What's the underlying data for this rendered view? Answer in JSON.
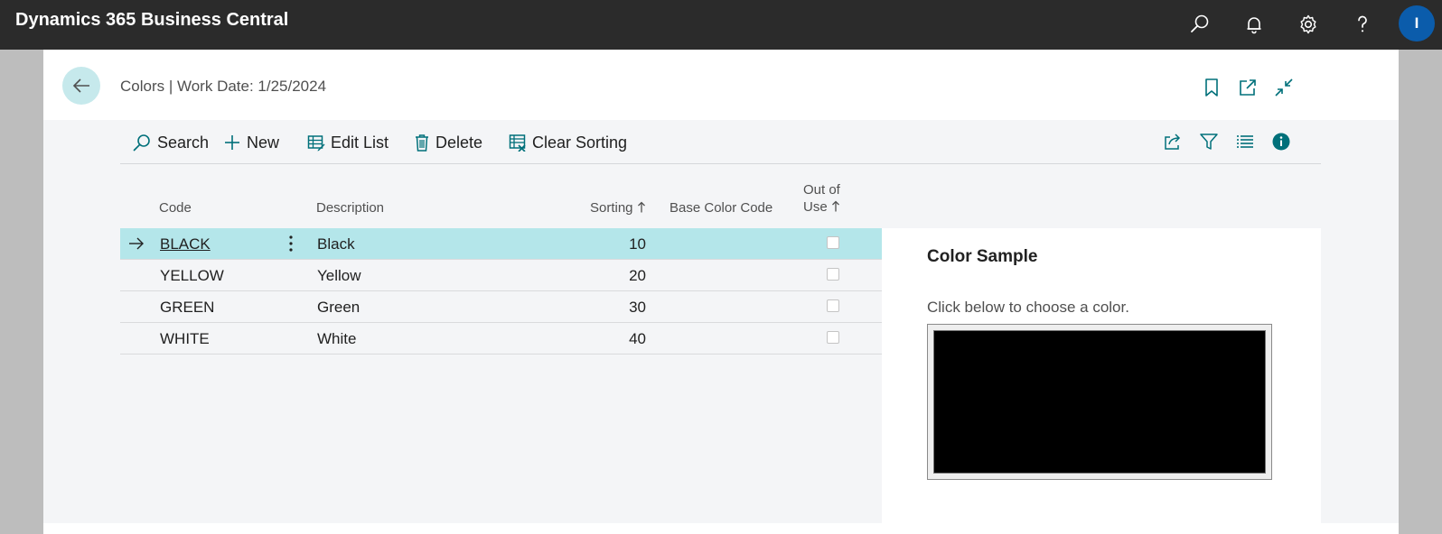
{
  "app": {
    "title": "Dynamics 365 Business Central",
    "user_initial": "I",
    "icons": [
      "search-icon",
      "bell-icon",
      "gear-icon",
      "help-icon"
    ]
  },
  "page": {
    "title": "Colors | Work Date: 1/25/2024"
  },
  "actions": {
    "search": "Search",
    "new": "New",
    "edit_list": "Edit List",
    "delete": "Delete",
    "clear_sorting": "Clear Sorting"
  },
  "list": {
    "columns": {
      "code": "Code",
      "description": "Description",
      "sorting": "Sorting",
      "base_color_code": "Base Color Code",
      "out_of_use_line1": "Out of",
      "out_of_use_line2": "Use"
    },
    "rows": [
      {
        "code": "BLACK",
        "description": "Black",
        "sorting": "10",
        "base_color_code": "",
        "out_of_use": false,
        "selected": true
      },
      {
        "code": "YELLOW",
        "description": "Yellow",
        "sorting": "20",
        "base_color_code": "",
        "out_of_use": false,
        "selected": false
      },
      {
        "code": "GREEN",
        "description": "Green",
        "sorting": "30",
        "base_color_code": "",
        "out_of_use": false,
        "selected": false
      },
      {
        "code": "WHITE",
        "description": "White",
        "sorting": "40",
        "base_color_code": "",
        "out_of_use": false,
        "selected": false
      }
    ]
  },
  "factbox": {
    "title": "Color Sample",
    "hint": "Click below to choose a color.",
    "sample_color": "#000000"
  },
  "colors": {
    "accent": "#00707a",
    "selected_row": "#b4e6ea",
    "app_bar": "#2b2b2b"
  }
}
